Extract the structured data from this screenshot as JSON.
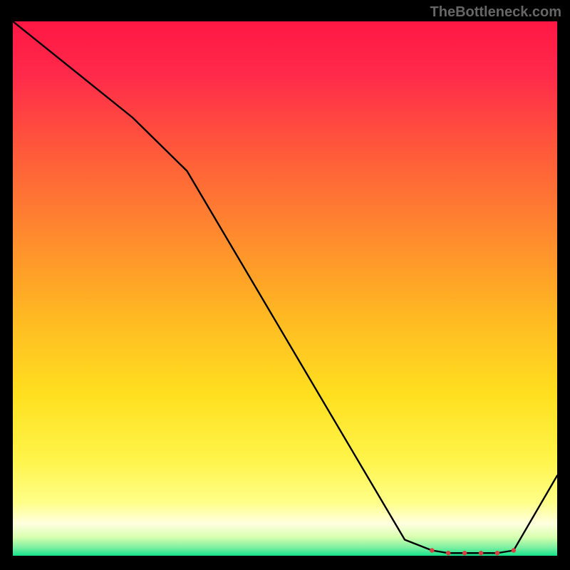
{
  "watermark": "TheBottleneck.com",
  "chart_data": {
    "type": "line",
    "title": "",
    "xlabel": "",
    "ylabel": "",
    "xlim": [
      0,
      100
    ],
    "ylim": [
      0,
      100
    ],
    "series": [
      {
        "name": "curve",
        "x": [
          0,
          22,
          32,
          72,
          77,
          80,
          83,
          86,
          89,
          92,
          100
        ],
        "values": [
          100,
          82,
          72,
          3,
          1,
          0.5,
          0.5,
          0.5,
          0.5,
          1,
          15
        ]
      }
    ],
    "markers": {
      "name": "red-dots",
      "x": [
        77,
        80,
        83,
        86,
        89,
        92
      ],
      "values": [
        1,
        0.5,
        0.5,
        0.5,
        0.5,
        1
      ],
      "color": "#d84040",
      "size": 3.2
    },
    "background_gradient": {
      "top": "#ff1744",
      "mid": "#ffe020",
      "bottom": "#14e08a"
    }
  },
  "colors": {
    "curve_stroke": "#000000",
    "marker": "#d84040",
    "watermark": "#666666"
  }
}
